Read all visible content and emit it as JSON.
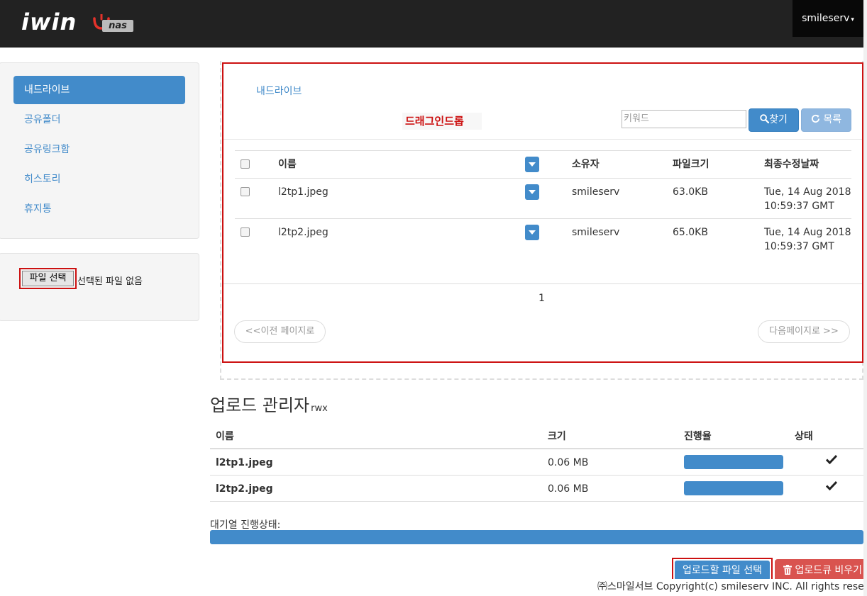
{
  "navbar": {
    "logo_text": "iwin",
    "logo_badge": "nas",
    "user": "smileserv"
  },
  "sidebar": {
    "items": [
      {
        "label": "내드라이브",
        "active": true
      },
      {
        "label": "공유폴더",
        "active": false
      },
      {
        "label": "공유링크함",
        "active": false
      },
      {
        "label": "히스토리",
        "active": false
      },
      {
        "label": "휴지통",
        "active": false
      }
    ]
  },
  "file_picker": {
    "button_label": "파일 선택",
    "status": "선택된 파일 없음"
  },
  "drive": {
    "breadcrumb": "내드라이브",
    "drag_label": "드래그인드롭",
    "search_placeholder": "키워드",
    "search_button": "찾기",
    "list_button": "목록",
    "columns": {
      "name": "이름",
      "owner": "소유자",
      "size": "파일크기",
      "modified": "최종수정날짜"
    },
    "files": [
      {
        "name": "l2tp1.jpeg",
        "owner": "smileserv",
        "size": "63.0KB",
        "modified_date": "Tue, 14 Aug 2018",
        "modified_time": "10:59:37 GMT"
      },
      {
        "name": "l2tp2.jpeg",
        "owner": "smileserv",
        "size": "65.0KB",
        "modified_date": "Tue, 14 Aug 2018",
        "modified_time": "10:59:37 GMT"
      }
    ],
    "page": "1",
    "prev_label": "<<이전 페이지로",
    "next_label": "다음페이지로 >>"
  },
  "upload_manager": {
    "title": "업로드 관리자",
    "subtitle": "rwx",
    "columns": {
      "name": "이름",
      "size": "크기",
      "progress": "진행율",
      "status": "상태"
    },
    "rows": [
      {
        "name": "l2tp1.jpeg",
        "size": "0.06 MB",
        "progress": 1.0
      },
      {
        "name": "l2tp2.jpeg",
        "size": "0.06 MB",
        "progress": 1.0
      }
    ],
    "queue_label": "대기열 진행상태:",
    "queue_progress": 1.0,
    "select_button": "업로드할 파일 선택",
    "clear_button": "업로드큐 비우기"
  },
  "footer": "㈜스마일서브 Copyright(c) smileserv INC. All rights reserved.",
  "colors": {
    "primary": "#428bca",
    "danger": "#d9534f",
    "highlight": "#cc1111",
    "navbar": "#222222"
  }
}
